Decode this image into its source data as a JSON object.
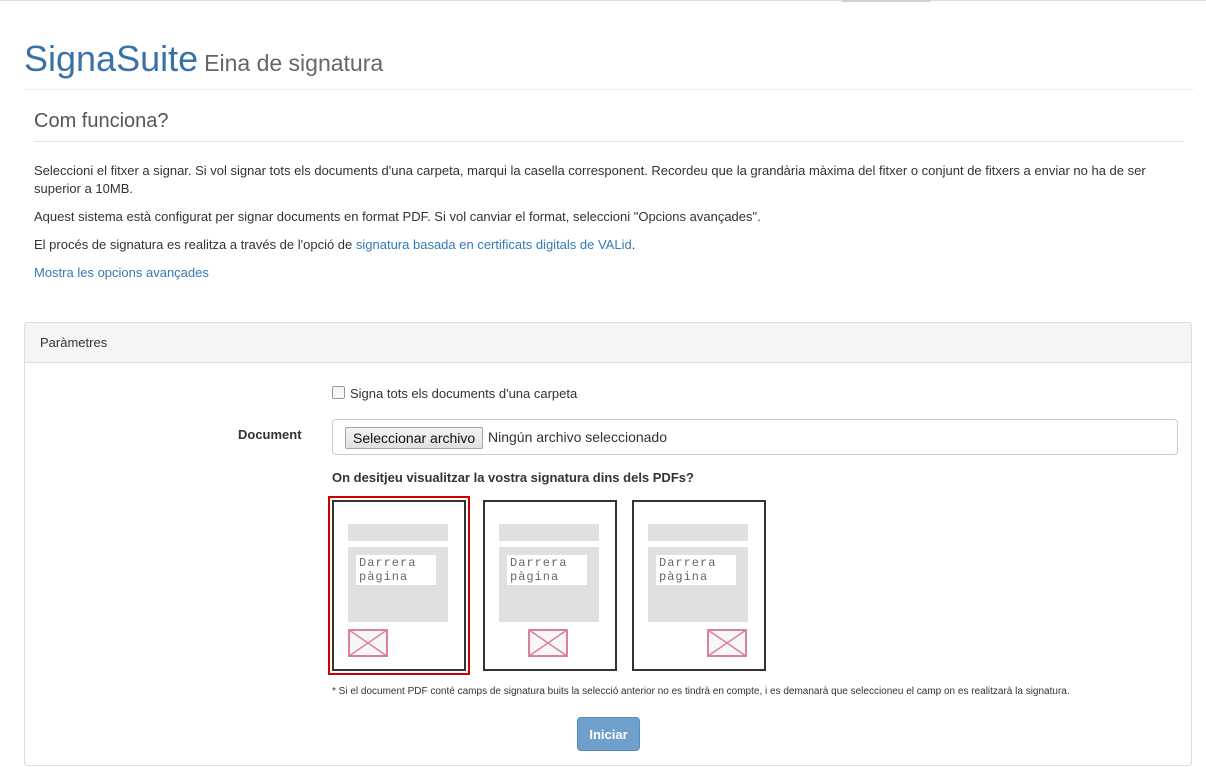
{
  "brand": {
    "name": "SignaSuite",
    "subtitle": "Eina de signatura"
  },
  "howto": {
    "title": "Com funciona?",
    "p1": "Seleccioni el fitxer a signar. Si vol signar tots els documents d'una carpeta, marqui la casella corresponent. Recordeu que la grandària màxima del fitxer o conjunt de fitxers a enviar no ha de ser superior a 10MB.",
    "p2": "Aquest sistema està configurat per signar documents en format PDF. Si vol canviar el format, seleccioni \"Opcions avançades\".",
    "p3_prefix": "El procés de signatura es realitza a través de l'opció de ",
    "p3_link": "signatura basada en certificats digitals de VALid",
    "p3_suffix": ".",
    "advanced_link": "Mostra les opcions avançades"
  },
  "panel": {
    "title": "Paràmetres",
    "folder_checkbox_label": "Signa tots els documents d'una carpeta",
    "folder_checkbox_checked": false,
    "document_label": "Document",
    "file_button": "Seleccionar archivo",
    "file_status": "Ningún archivo seleccionado",
    "question": "On desitjeu visualitzar la vostra signatura dins dels PDFs?",
    "options": [
      {
        "label": "Darrera pàgina",
        "position": "bottom-left",
        "selected": true
      },
      {
        "label": "Darrera pàgina",
        "position": "bottom-center",
        "selected": false
      },
      {
        "label": "Darrera pàgina",
        "position": "bottom-right",
        "selected": false
      }
    ],
    "note": "* Si el document PDF conté camps de signatura buits la selecció anterior no es tindrà en compte, i es demanarà que seleccioneu el camp on es realitzarà la signatura.",
    "start_button": "Iniciar"
  },
  "colors": {
    "brand": "#3a72a8",
    "link": "#337ab7",
    "selected_outline": "#cc0000",
    "envelope": "#d9809e",
    "button": "#6f9fcb"
  }
}
